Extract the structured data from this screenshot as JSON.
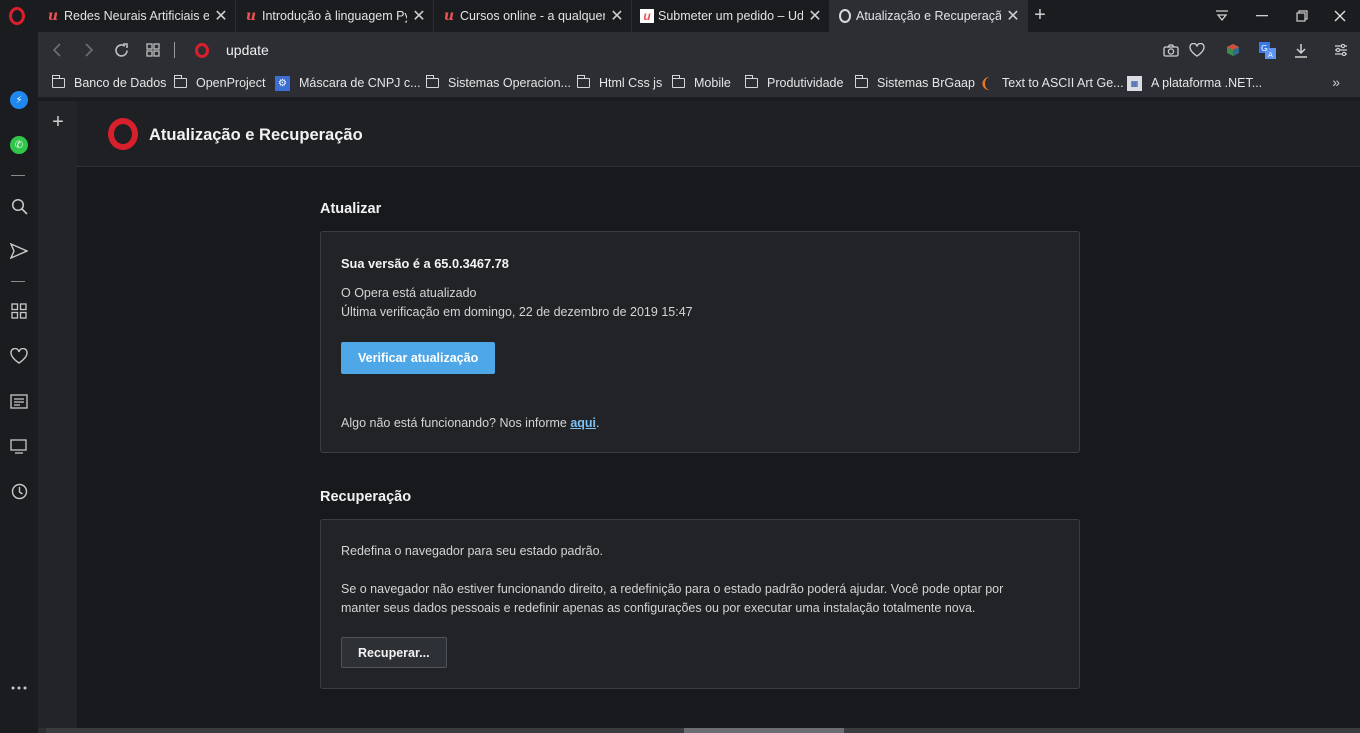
{
  "tabs": [
    {
      "title": "Redes Neurais Artificiais em",
      "favicon": "udemy-icon",
      "active": false
    },
    {
      "title": "Introdução à linguagem Py",
      "favicon": "udemy-icon",
      "active": false
    },
    {
      "title": "Cursos online - a qualquer",
      "favicon": "udemy-icon",
      "active": false
    },
    {
      "title": "Submeter um pedido – Ude",
      "favicon": "udemy-box-icon",
      "active": false
    },
    {
      "title": "Atualização e Recuperação",
      "favicon": "opera-icon",
      "active": true
    }
  ],
  "address": {
    "url": "update"
  },
  "bookmarks": [
    {
      "label": "Banco de Dados",
      "icon": "folder-icon"
    },
    {
      "label": "OpenProject",
      "icon": "folder-icon"
    },
    {
      "label": "Máscara de CNPJ c...",
      "icon": "gear-icon"
    },
    {
      "label": "Sistemas Operacion...",
      "icon": "folder-icon"
    },
    {
      "label": "Html Css js",
      "icon": "folder-icon"
    },
    {
      "label": "Mobile",
      "icon": "folder-icon"
    },
    {
      "label": "Produtividade",
      "icon": "folder-icon"
    },
    {
      "label": "Sistemas BrGaap",
      "icon": "folder-icon"
    },
    {
      "label": "Text to ASCII Art Ge...",
      "icon": "ascii-art-icon"
    },
    {
      "label": "A plataforma .NET...",
      "icon": "dotnet-icon"
    }
  ],
  "page": {
    "title": "Atualização e Recuperação",
    "update": {
      "section_title": "Atualizar",
      "version": "Sua versão é a 65.0.3467.78",
      "status": "O Opera está atualizado",
      "last_check": "Última verificação em domingo, 22 de dezembro de 2019 15:47",
      "check_button": "Verificar atualização",
      "report_prefix": "Algo não está funcionando? Nos informe ",
      "report_link": "aqui",
      "report_suffix": "."
    },
    "recovery": {
      "section_title": "Recuperação",
      "intro": "Redefina o navegador para seu estado padrão.",
      "desc_line1": "Se o navegador não estiver funcionando direito, a redefinição para o estado padrão poderá ajudar. Você pode optar por",
      "desc_line2": "manter seus dados pessoais e redefinir apenas as configurações ou por executar uma instalação totalmente nova.",
      "recover_button": "Recuperar..."
    }
  },
  "colors": {
    "accent": "#4ea7e6",
    "opera_red": "#d8202c",
    "link": "#7cc1f2"
  }
}
